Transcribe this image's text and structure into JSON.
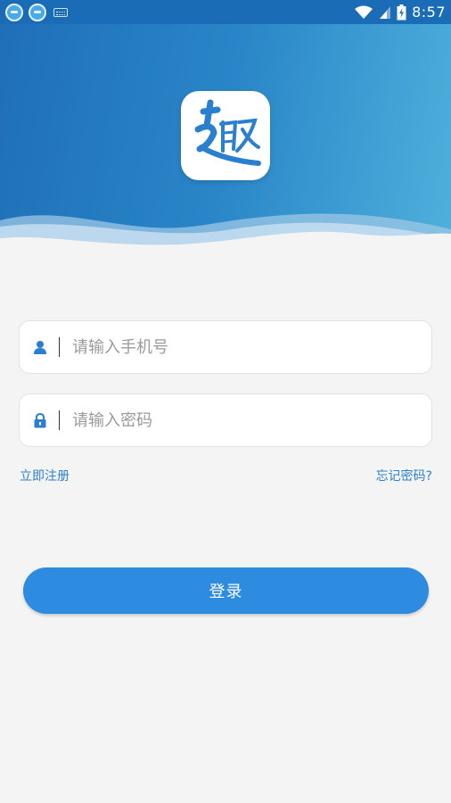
{
  "status_bar": {
    "time": "8:57",
    "icons": [
      "app-notification-icon",
      "app-notification-icon",
      "keyboard-icon",
      "wifi-icon",
      "signal-icon",
      "battery-charging-icon"
    ]
  },
  "header": {
    "logo_icon": "qu-logo-icon",
    "gradient_colors": [
      "#1f6fb8",
      "#4fb0dc"
    ]
  },
  "form": {
    "phone": {
      "placeholder": "请输入手机号",
      "value": "",
      "icon": "user-icon"
    },
    "password": {
      "placeholder": "请输入密码",
      "value": "",
      "icon": "lock-icon"
    },
    "register_link": "立即注册",
    "forgot_link": "忘记密码?",
    "login_button": "登录"
  },
  "colors": {
    "accent": "#2d8ce0",
    "link": "#2b7fd1",
    "background": "#f4f4f4"
  }
}
